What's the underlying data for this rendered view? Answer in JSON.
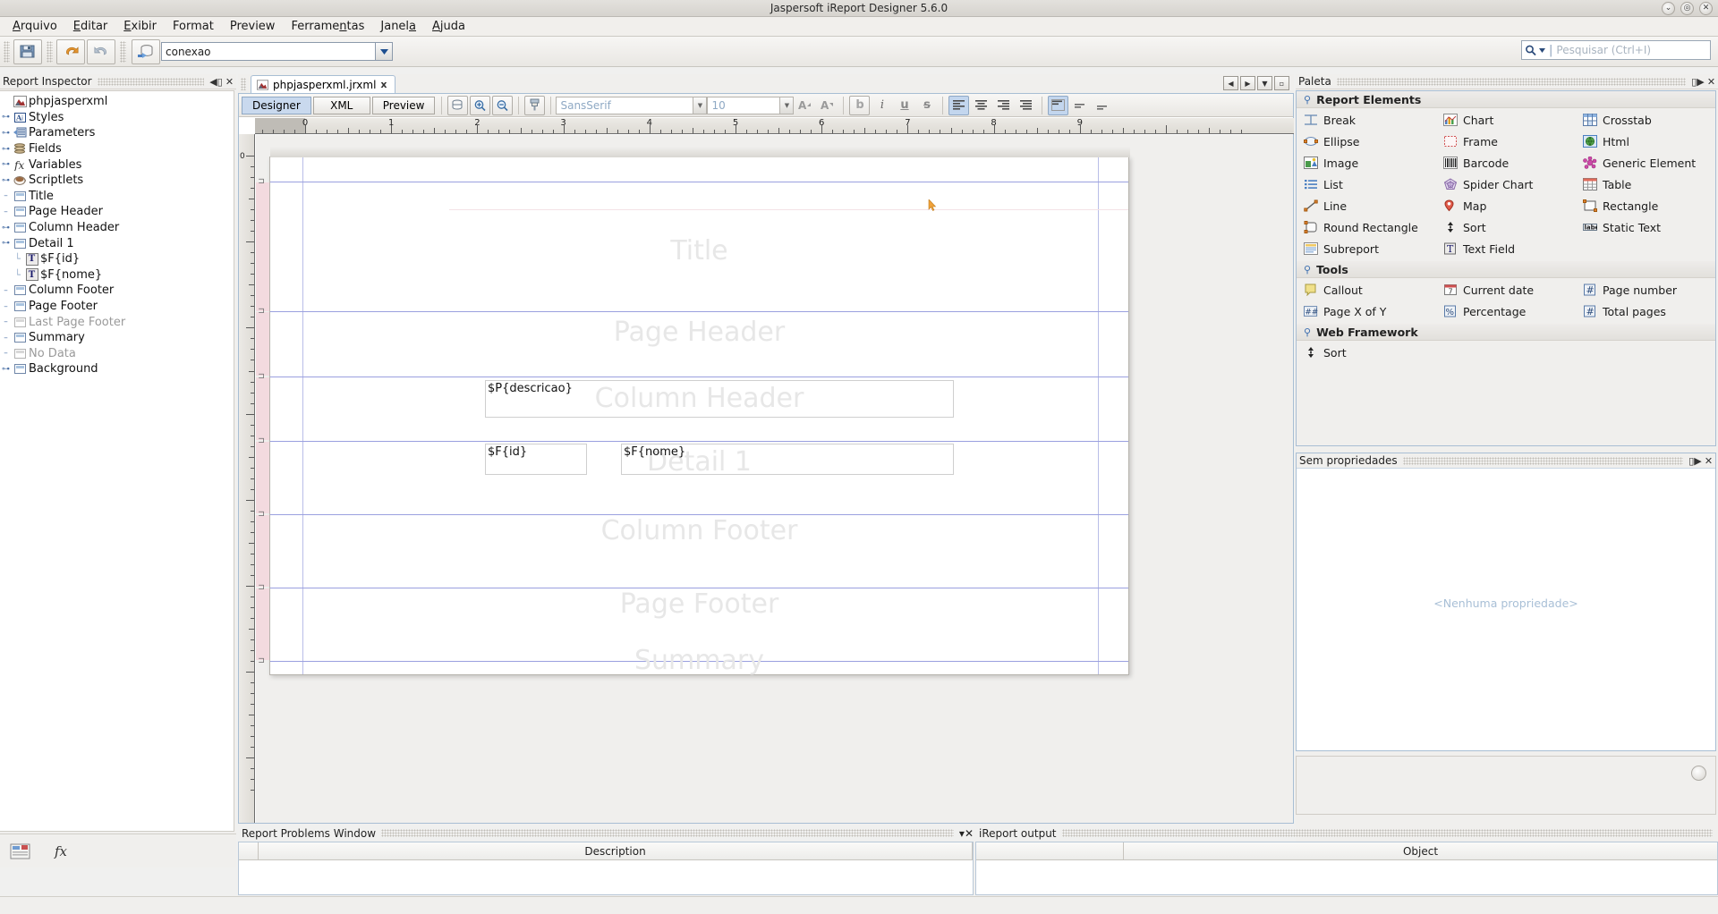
{
  "window": {
    "title": "Jaspersoft iReport Designer 5.6.0",
    "controls": [
      {
        "name": "minimize",
        "glyph": "⌄"
      },
      {
        "name": "maximize",
        "glyph": "◎"
      },
      {
        "name": "close",
        "glyph": "✕"
      }
    ]
  },
  "menubar": {
    "items": [
      {
        "label": "Arquivo",
        "mnemonic": "A"
      },
      {
        "label": "Editar",
        "mnemonic": "E"
      },
      {
        "label": "Exibir",
        "mnemonic": "E"
      },
      {
        "label": "Format",
        "mnemonic": "F"
      },
      {
        "label": "Preview",
        "mnemonic": "P"
      },
      {
        "label": "Ferramentas",
        "mnemonic": "n"
      },
      {
        "label": "Janela",
        "mnemonic": "a"
      },
      {
        "label": "Ajuda",
        "mnemonic": "A"
      }
    ]
  },
  "toolbar": {
    "save_icon": "save-icon",
    "undo_icon": "undo-icon",
    "redo_icon": "redo-icon",
    "connection_icon": "database-connection-icon",
    "connection_value": "conexao",
    "search_placeholder": "Pesquisar (Ctrl+I)",
    "search_icon": "search-icon"
  },
  "inspector": {
    "title": "Report Inspector",
    "collapse_icon": "collapse-icon",
    "close_icon": "close-icon",
    "root": "phpjasperxml",
    "nodes": [
      {
        "label": "Styles",
        "icon": "styles-icon",
        "expandable": true,
        "indent": 1,
        "dim": false
      },
      {
        "label": "Parameters",
        "icon": "parameters-icon",
        "expandable": true,
        "indent": 1,
        "dim": false
      },
      {
        "label": "Fields",
        "icon": "fields-icon",
        "expandable": true,
        "indent": 1,
        "dim": false
      },
      {
        "label": "Variables",
        "icon": "variables-icon",
        "expandable": true,
        "indent": 1,
        "dim": false
      },
      {
        "label": "Scriptlets",
        "icon": "scriptlets-icon",
        "expandable": true,
        "indent": 1,
        "dim": false
      },
      {
        "label": "Title",
        "icon": "band-icon",
        "expandable": false,
        "indent": 1,
        "dim": false
      },
      {
        "label": "Page Header",
        "icon": "band-icon",
        "expandable": false,
        "indent": 1,
        "dim": false
      },
      {
        "label": "Column Header",
        "icon": "band-icon",
        "expandable": true,
        "indent": 1,
        "dim": false
      },
      {
        "label": "Detail 1",
        "icon": "band-icon",
        "expandable": true,
        "expanded": true,
        "indent": 1,
        "dim": false
      },
      {
        "label": "$F{id}",
        "icon": "textfield-icon",
        "expandable": false,
        "indent": 2,
        "dim": false
      },
      {
        "label": "$F{nome}",
        "icon": "textfield-icon",
        "expandable": false,
        "indent": 2,
        "dim": false
      },
      {
        "label": "Column Footer",
        "icon": "band-icon",
        "expandable": false,
        "indent": 1,
        "dim": false
      },
      {
        "label": "Page Footer",
        "icon": "band-icon",
        "expandable": false,
        "indent": 1,
        "dim": false
      },
      {
        "label": "Last Page Footer",
        "icon": "band-icon",
        "expandable": false,
        "indent": 1,
        "dim": true
      },
      {
        "label": "Summary",
        "icon": "band-icon",
        "expandable": false,
        "indent": 1,
        "dim": false
      },
      {
        "label": "No Data",
        "icon": "band-icon",
        "expandable": false,
        "indent": 1,
        "dim": true
      },
      {
        "label": "Background",
        "icon": "band-icon",
        "expandable": true,
        "indent": 1,
        "dim": false
      }
    ],
    "footer_buttons": [
      {
        "name": "report-inspector-button",
        "icon": "report-inspector-icon"
      },
      {
        "name": "expression-editor-button",
        "icon": "fx-icon"
      }
    ]
  },
  "editor": {
    "document_tab": {
      "label": "phpjasperxml.jrxml",
      "close": "x",
      "icon": "jrxml-file-icon"
    },
    "tab_nav": [
      {
        "name": "prev-tab-button",
        "glyph": "◄"
      },
      {
        "name": "next-tab-button",
        "glyph": "►"
      },
      {
        "name": "tab-list-button",
        "glyph": "▼"
      },
      {
        "name": "maximize-editor-button",
        "glyph": "□"
      }
    ],
    "view_tabs": [
      {
        "label": "Designer",
        "active": true
      },
      {
        "label": "XML",
        "active": false
      },
      {
        "label": "Preview",
        "active": false
      }
    ],
    "tools": [
      {
        "name": "report-query-button",
        "icon": "database-icon"
      },
      {
        "name": "zoom-in-button",
        "icon": "zoom-in-icon"
      },
      {
        "name": "zoom-out-button",
        "icon": "zoom-out-icon"
      },
      {
        "name": "format-painter-button",
        "icon": "format-painter-icon"
      }
    ],
    "font_family": "SansSerif",
    "font_size": "10",
    "format_buttons": [
      {
        "name": "increase-font-button",
        "label": "A",
        "icon": "font-increase-icon"
      },
      {
        "name": "decrease-font-button",
        "label": "A",
        "icon": "font-decrease-icon"
      },
      {
        "name": "bold-button",
        "label": "b",
        "icon": "bold-icon"
      },
      {
        "name": "italic-button",
        "label": "i",
        "icon": "italic-icon"
      },
      {
        "name": "underline-button",
        "label": "u",
        "icon": "underline-icon"
      },
      {
        "name": "strikethrough-button",
        "label": "s",
        "icon": "strikethrough-icon"
      }
    ],
    "align_buttons": [
      {
        "name": "align-left-button",
        "icon": "align-left-icon",
        "active": true
      },
      {
        "name": "align-center-button",
        "icon": "align-center-icon",
        "active": false
      },
      {
        "name": "align-right-button",
        "icon": "align-right-icon",
        "active": false
      },
      {
        "name": "align-justify-button",
        "icon": "align-justify-icon",
        "active": false
      },
      {
        "name": "valign-top-button",
        "icon": "valign-top-icon",
        "active": true
      },
      {
        "name": "valign-middle-button",
        "icon": "valign-middle-icon",
        "active": false
      },
      {
        "name": "valign-bottom-button",
        "icon": "valign-bottom-icon",
        "active": false
      }
    ],
    "ruler_h_labels": [
      "0",
      "1",
      "2",
      "3",
      "4",
      "5",
      "6",
      "7",
      "8",
      "9"
    ],
    "bands": [
      {
        "name": "Title",
        "label": "Title"
      },
      {
        "name": "Page Header",
        "label": "Page Header"
      },
      {
        "name": "Column Header",
        "label": "Column Header"
      },
      {
        "name": "Detail 1",
        "label": "Detail 1"
      },
      {
        "name": "Column Footer",
        "label": "Column Footer"
      },
      {
        "name": "Page Footer",
        "label": "Page Footer"
      },
      {
        "name": "Summary",
        "label": "Summary"
      }
    ],
    "elements": [
      {
        "name": "param-descricao-textfield",
        "text": "$P{descricao}",
        "band": "Column Header"
      },
      {
        "name": "field-id-textfield",
        "text": "$F{id}",
        "band": "Detail 1"
      },
      {
        "name": "field-nome-textfield",
        "text": "$F{nome}",
        "band": "Detail 1"
      }
    ]
  },
  "palette": {
    "title": "Paleta",
    "collapse_icon": "collapse-icon",
    "close_icon": "close-icon",
    "sections": [
      {
        "title": "Report Elements",
        "items": [
          {
            "label": "Break",
            "icon": "break-icon"
          },
          {
            "label": "Chart",
            "icon": "chart-icon"
          },
          {
            "label": "Crosstab",
            "icon": "crosstab-icon"
          },
          {
            "label": "Ellipse",
            "icon": "ellipse-icon"
          },
          {
            "label": "Frame",
            "icon": "frame-icon"
          },
          {
            "label": "Html",
            "icon": "html-icon"
          },
          {
            "label": "Image",
            "icon": "image-icon"
          },
          {
            "label": "Barcode",
            "icon": "barcode-icon"
          },
          {
            "label": "Generic Element",
            "icon": "generic-element-icon"
          },
          {
            "label": "List",
            "icon": "list-icon"
          },
          {
            "label": "Spider Chart",
            "icon": "spider-chart-icon"
          },
          {
            "label": "Table",
            "icon": "table-icon"
          },
          {
            "label": "Line",
            "icon": "line-icon"
          },
          {
            "label": "Map",
            "icon": "map-icon"
          },
          {
            "label": "Rectangle",
            "icon": "rectangle-icon"
          },
          {
            "label": "Round Rectangle",
            "icon": "round-rectangle-icon"
          },
          {
            "label": "Sort",
            "icon": "sort-icon"
          },
          {
            "label": "Static Text",
            "icon": "static-text-icon"
          },
          {
            "label": "Subreport",
            "icon": "subreport-icon"
          },
          {
            "label": "Text Field",
            "icon": "text-field-icon"
          }
        ]
      },
      {
        "title": "Tools",
        "items": [
          {
            "label": "Callout",
            "icon": "callout-icon"
          },
          {
            "label": "Current date",
            "icon": "current-date-icon"
          },
          {
            "label": "Page number",
            "icon": "page-number-icon"
          },
          {
            "label": "Page X of Y",
            "icon": "page-x-of-y-icon"
          },
          {
            "label": "Percentage",
            "icon": "percentage-icon"
          },
          {
            "label": "Total pages",
            "icon": "total-pages-icon"
          }
        ]
      },
      {
        "title": "Web Framework",
        "items": [
          {
            "label": "Sort",
            "icon": "sort-icon"
          }
        ]
      }
    ]
  },
  "properties": {
    "title": "Sem propriedades",
    "empty_text": "<Nenhuma propriedade>",
    "collapse_icon": "collapse-icon",
    "close_icon": "close-icon"
  },
  "bottom": {
    "problems": {
      "title": "Report Problems Window",
      "minimize_icon": "minimize-icon",
      "close_icon": "close-icon",
      "columns": [
        "",
        "Description"
      ]
    },
    "output": {
      "title": "iReport output",
      "columns": [
        "",
        "Object"
      ]
    }
  },
  "colors": {
    "accent": "#c9d9ee",
    "band_guide": "#9aa0df",
    "margin_guide": "#b9bde8",
    "band_label": "#e7e7e7",
    "strip": "#f3dadf"
  }
}
